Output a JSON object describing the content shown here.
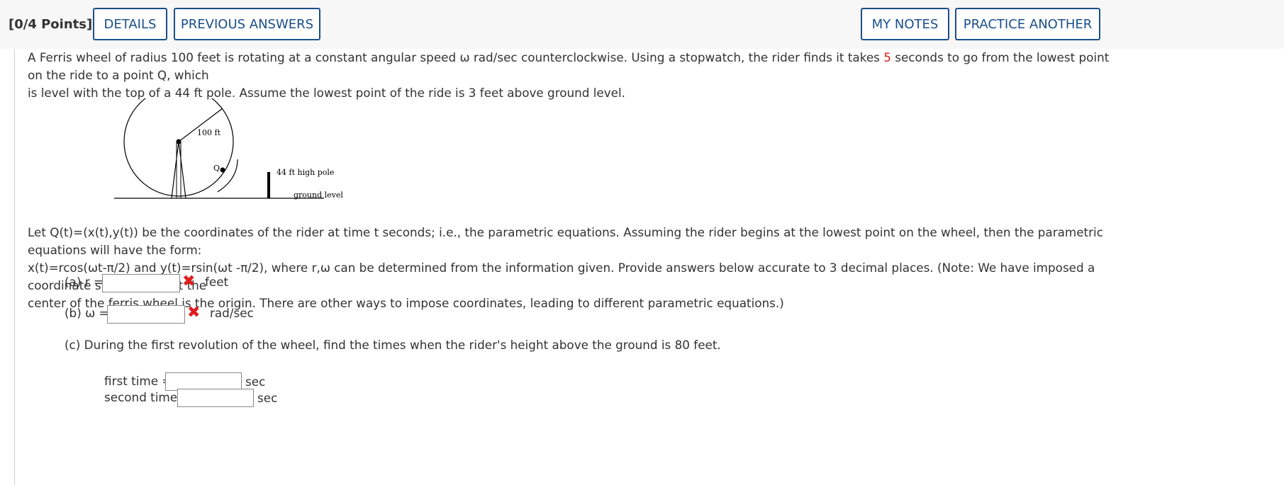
{
  "header": {
    "points": "[0/4 Points]",
    "details": "DETAILS",
    "previous_answers": "PREVIOUS ANSWERS",
    "my_notes": "MY NOTES",
    "practice_another": "PRACTICE ANOTHER"
  },
  "problem": {
    "intro_1": "A Ferris wheel of radius 100 feet is rotating at a constant angular speed ω rad/sec counterclockwise. Using a stopwatch, the rider finds it takes ",
    "seconds_value": "5",
    "intro_2": " seconds to go from the lowest point on the ride to a point Q, which",
    "intro_3": "is level with the top of a 44 ft pole. Assume the lowest point of the ride is 3 feet above ground level.",
    "diagram": {
      "radius_label": "100 ft",
      "q_label": "Q",
      "pole_label": "44 ft high pole",
      "ground_label": "ground level"
    },
    "param_1": "Let Q(t)=(x(t),y(t)) be the coordinates of the rider at time t seconds; i.e., the parametric equations. Assuming the rider begins at the lowest point on the wheel, then the parametric equations will have the form:",
    "param_2": "x(t)=rcos(ωt-π/2) and y(t)=rsin(ωt -π/2), where r,ω can be determined from the information given. Provide answers below accurate to 3 decimal places. (Note: We have imposed a coordinate system so that the",
    "param_3": "center of the ferris wheel is the origin. There are other ways to impose coordinates, leading to different parametric equations.)"
  },
  "answers": {
    "a_label": "(a) r =",
    "a_value": "",
    "a_unit": "feet",
    "b_label": "(b) ω =",
    "b_value": "",
    "b_unit": "rad/sec",
    "c_text": "(c) During the first revolution of the wheel, find the times when the rider's height above the ground is 80 feet.",
    "first_label": "first time =",
    "first_value": "",
    "first_unit": "sec",
    "second_label": "second time=",
    "second_value": "",
    "second_unit": "sec",
    "incorrect_icon": "x-mark-icon"
  },
  "colors": {
    "accent": "#1a4f8a",
    "error": "#e01b1b"
  }
}
